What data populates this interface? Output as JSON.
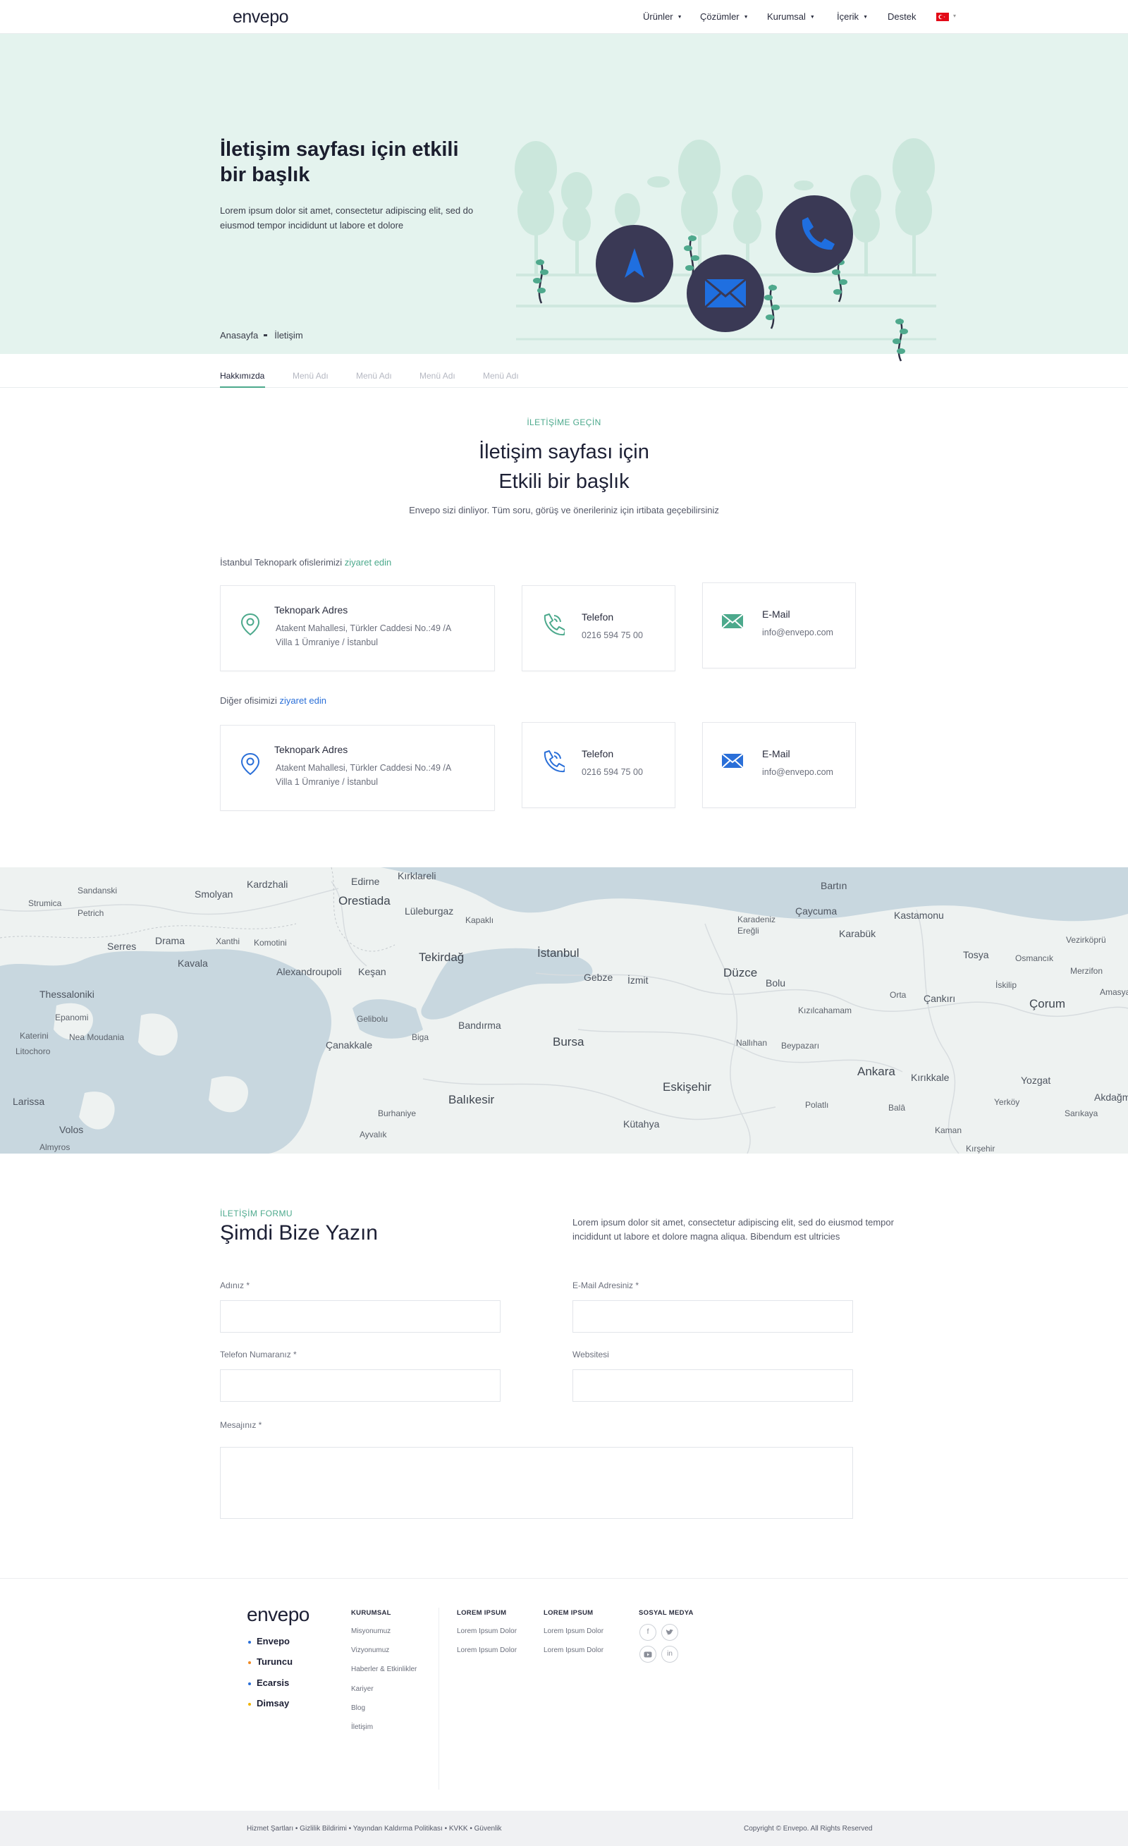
{
  "header": {
    "logo": "envepo",
    "nav": [
      {
        "label": "Ürünler",
        "caret": "▼"
      },
      {
        "label": "Çözümler",
        "caret": "▼"
      },
      {
        "label": "Kurumsal",
        "caret": "▼"
      },
      {
        "label": "İçerik",
        "caret": "▼"
      },
      {
        "label": "Destek",
        "caret": ""
      }
    ],
    "language_caret": "▾"
  },
  "hero": {
    "title": "İletişim sayfası için etkili bir başlık",
    "text": "Lorem ipsum dolor sit amet, consectetur adipiscing elit, sed do eiusmod tempor incididunt ut labore et dolore",
    "breadcrumb": [
      "Anasayfa",
      "İletişim"
    ]
  },
  "subnav": [
    "Hakkımızda",
    "Menü Adı",
    "Menü Adı",
    "Menü Adı",
    "Menü Adı"
  ],
  "intro": {
    "eyebrow": "İLETİŞİME GEÇİN",
    "title_line1": "İletişim sayfası için",
    "title_line2": "Etkili bir başlık",
    "text": "Envepo sizi dinliyor. Tüm soru, görüş ve önerileriniz için irtibata geçebilirsiniz"
  },
  "office1": {
    "label": "İstanbul Teknopark ofislerimizi",
    "visit": "ziyaret edin",
    "address_title": "Teknopark Adres",
    "address_line1": "Atakent Mahallesi, Türkler Caddesi No.:49 /A",
    "address_line2": "Villa 1 Ümraniye / İstanbul",
    "phone_title": "Telefon",
    "phone": "0216 594 75 00",
    "email_title": "E-Mail",
    "email": "info@envepo.com"
  },
  "office2": {
    "label": "Diğer ofisimizi",
    "visit": "ziyaret edin",
    "address_title": "Teknopark Adres",
    "address_line1": "Atakent Mahallesi, Türkler Caddesi No.:49 /A",
    "address_line2": "Villa 1 Ümraniye / İstanbul",
    "phone_title": "Telefon",
    "phone": "0216 594 75 00",
    "email_title": "E-Mail",
    "email": "info@envepo.com"
  },
  "map": {
    "labels": [
      "Sandanski",
      "Strumica",
      "Petrich",
      "Kardzhali",
      "Smolyan",
      "Edirne",
      "Kırklareli",
      "Orestiada",
      "Lüleburgaz",
      "Kapaklı",
      "Bartın",
      "Karadeniz Ereğli",
      "Çaycuma",
      "Kastamonu",
      "Serres",
      "Drama",
      "Xanthi",
      "Komotini",
      "Karabük",
      "Tosya",
      "Vezirköprü",
      "Kavala",
      "Alexandroupoli",
      "Keşan",
      "Tekirdağ",
      "İstanbul",
      "Gebze",
      "İzmit",
      "Düzce",
      "Bolu",
      "Osmancık",
      "Merzifon",
      "Thessaloniki",
      "İskilip",
      "Amasya",
      "Orta",
      "Çankırı",
      "Çorum",
      "Kızılcahamam",
      "Katerini",
      "Epanomi",
      "Nea Moudania",
      "Gelibolu",
      "Bandırma",
      "Litochoro",
      "Çanakkale",
      "Biga",
      "Bursa",
      "Nallıhan",
      "Beypazarı",
      "Ankara",
      "Kırıkkale",
      "Yozgat",
      "Akdağmadeni",
      "Eskişehir",
      "Larissa",
      "Balıkesir",
      "Polatlı",
      "Balâ",
      "Yerköy",
      "Sarıkaya",
      "Burhaniye",
      "Volos",
      "Kütahya",
      "Ayvalık",
      "Almyros",
      "Kaman",
      "Kırşehir"
    ]
  },
  "form": {
    "eyebrow": "İLETİŞİM FORMU",
    "title": "Şimdi Bize Yazın",
    "text": "Lorem ipsum dolor sit amet, consectetur adipiscing elit, sed do eiusmod tempor incididunt ut labore et dolore magna aliqua. Bibendum est ultricies",
    "name_label": "Adınız *",
    "email_label": "E-Mail Adresiniz *",
    "phone_label": "Telefon Numaranız *",
    "website_label": "Websitesi",
    "message_label": "Mesajınız *"
  },
  "footer": {
    "logo": "envepo",
    "brands": [
      {
        "name": "Envepo",
        "color": "#2a6fd8"
      },
      {
        "name": "Turuncu",
        "color": "#f08a24"
      },
      {
        "name": "Ecarsis",
        "color": "#2a6fd8"
      },
      {
        "name": "Dimsay",
        "color": "#f0b400"
      }
    ],
    "col1_head": "KURUMSAL",
    "col1_links": [
      "Misyonumuz",
      "Vizyonumuz",
      "Haberler & Etkinlikler",
      "Kariyer",
      "Blog",
      "İletişim"
    ],
    "col2_head": "LOREM IPSUM",
    "col2_links": [
      "Lorem Ipsum Dolor",
      "Lorem Ipsum Dolor"
    ],
    "col3_head": "LOREM IPSUM",
    "col3_links": [
      "Lorem Ipsum Dolor",
      "Lorem Ipsum Dolor"
    ],
    "social_head": "SOSYAL MEDYA",
    "social_icons": [
      "facebook-icon",
      "twitter-icon",
      "youtube-icon",
      "linkedin-icon"
    ],
    "bottom_links": "Hizmet Şartları  •  Gizlilik Bildirimi  •  Yayından Kaldırma Politikası  •  KVKK  •  Güvenlik",
    "copyright": "Copyright © Envepo. All Rights Reserved"
  },
  "colors": {
    "accent_green": "#4ca98c",
    "accent_blue": "#2a6fd8",
    "hero_bg": "#e4f3ee",
    "dark_circle": "#3a3955"
  }
}
